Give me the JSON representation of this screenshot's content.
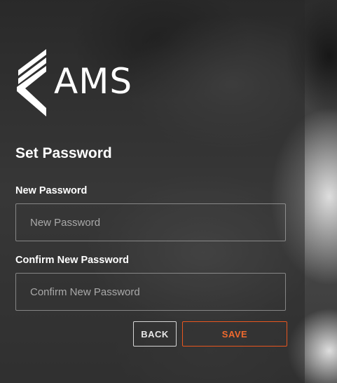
{
  "brand": {
    "name": "AMS",
    "logo_icon": "ams-chevron-logo-icon"
  },
  "form": {
    "title": "Set Password",
    "new_password": {
      "label": "New Password",
      "placeholder": "New Password",
      "value": ""
    },
    "confirm_password": {
      "label": "Confirm New Password",
      "placeholder": "Confirm New Password",
      "value": ""
    },
    "back_label": "BACK",
    "save_label": "SAVE"
  },
  "colors": {
    "accent": "#e8561f",
    "panel_overlay": "#282828",
    "text": "#ffffff"
  }
}
